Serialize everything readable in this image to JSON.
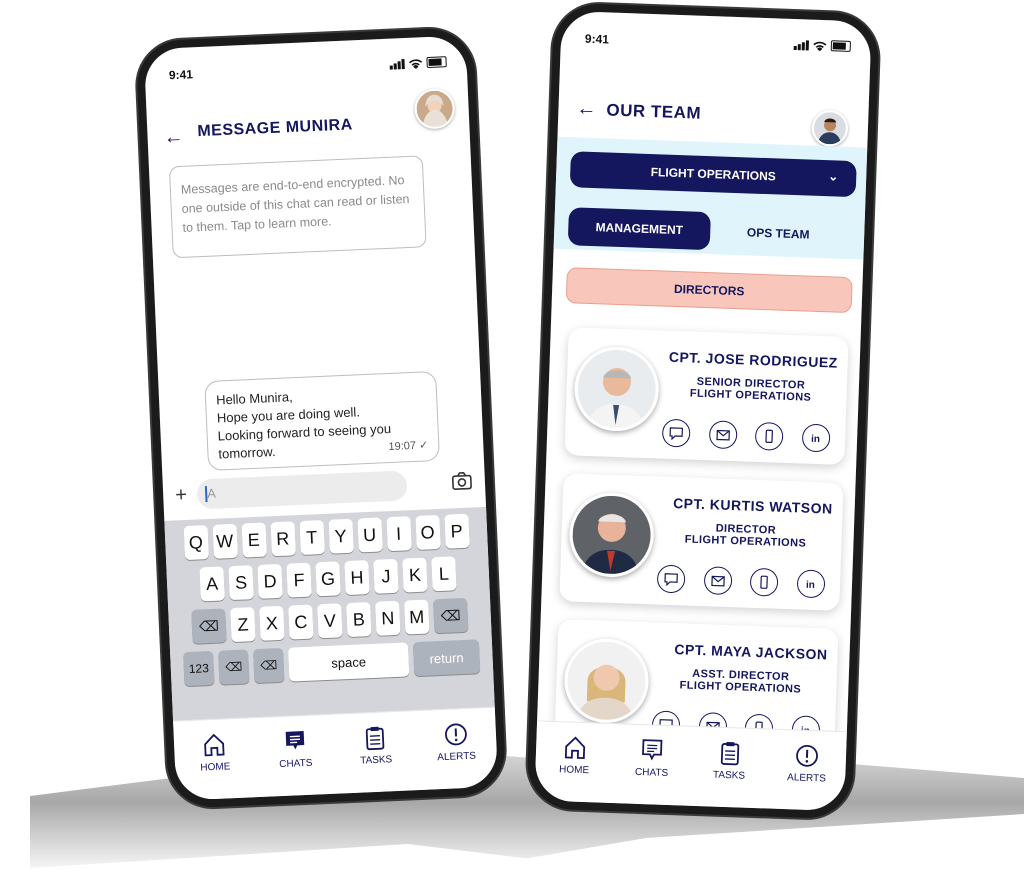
{
  "left_phone": {
    "status": {
      "time": "9:41"
    },
    "header": {
      "title": "MESSAGE MUNIRA"
    },
    "notice": "Messages are end-to-end encrypted. No one outside of this chat can read or listen to them. Tap to learn more.",
    "message": {
      "lines": [
        "Hello Munira,",
        "Hope you are doing well.",
        "Looking forward to seeing you",
        "tomorrow."
      ],
      "time": "19:07",
      "read_icon": "check-icon"
    },
    "composer": {
      "placeholder": "A",
      "add_icon": "plus-icon",
      "camera_icon": "camera-icon"
    },
    "keyboard": {
      "row1": [
        "Q",
        "W",
        "E",
        "R",
        "T",
        "Y",
        "U",
        "I",
        "O",
        "P"
      ],
      "row2": [
        "A",
        "S",
        "D",
        "F",
        "G",
        "H",
        "J",
        "K",
        "L"
      ],
      "row3": [
        "Z",
        "X",
        "C",
        "V",
        "B",
        "N",
        "M"
      ],
      "num_label": "123",
      "space_label": "space",
      "return_label": "return"
    },
    "nav": [
      {
        "label": "HOME",
        "icon": "home-icon"
      },
      {
        "label": "CHATS",
        "icon": "chat-icon"
      },
      {
        "label": "TASKS",
        "icon": "clipboard-icon"
      },
      {
        "label": "ALERTS",
        "icon": "alert-icon"
      }
    ]
  },
  "right_phone": {
    "status": {
      "time": "9:41"
    },
    "header": {
      "title": "OUR TEAM"
    },
    "dropdown": {
      "value": "FLIGHT OPERATIONS"
    },
    "tabs": [
      {
        "label": "MANAGEMENT",
        "active": true
      },
      {
        "label": "OPS TEAM",
        "active": false
      }
    ],
    "section": "DIRECTORS",
    "cards": [
      {
        "name": "CPT. JOSE RODRIGUEZ",
        "role_line1": "SENIOR DIRECTOR",
        "role_line2": "FLIGHT OPERATIONS"
      },
      {
        "name": "CPT. KURTIS WATSON",
        "role_line1": "DIRECTOR",
        "role_line2": "FLIGHT OPERATIONS"
      },
      {
        "name": "CPT. MAYA JACKSON",
        "role_line1": "ASST. DIRECTOR",
        "role_line2": "FLIGHT OPERATIONS"
      }
    ],
    "card_actions": [
      "message-icon",
      "email-icon",
      "phone-icon",
      "linkedin-icon"
    ],
    "nav": [
      {
        "label": "HOME",
        "icon": "home-icon"
      },
      {
        "label": "CHATS",
        "icon": "chat-icon"
      },
      {
        "label": "TASKS",
        "icon": "clipboard-icon"
      },
      {
        "label": "ALERTS",
        "icon": "alert-icon"
      }
    ]
  },
  "colors": {
    "navy": "#14165e",
    "light_blue": "#dff4fb",
    "salmon": "#f9c6bb",
    "keyboard_bg": "#d3d5db"
  }
}
